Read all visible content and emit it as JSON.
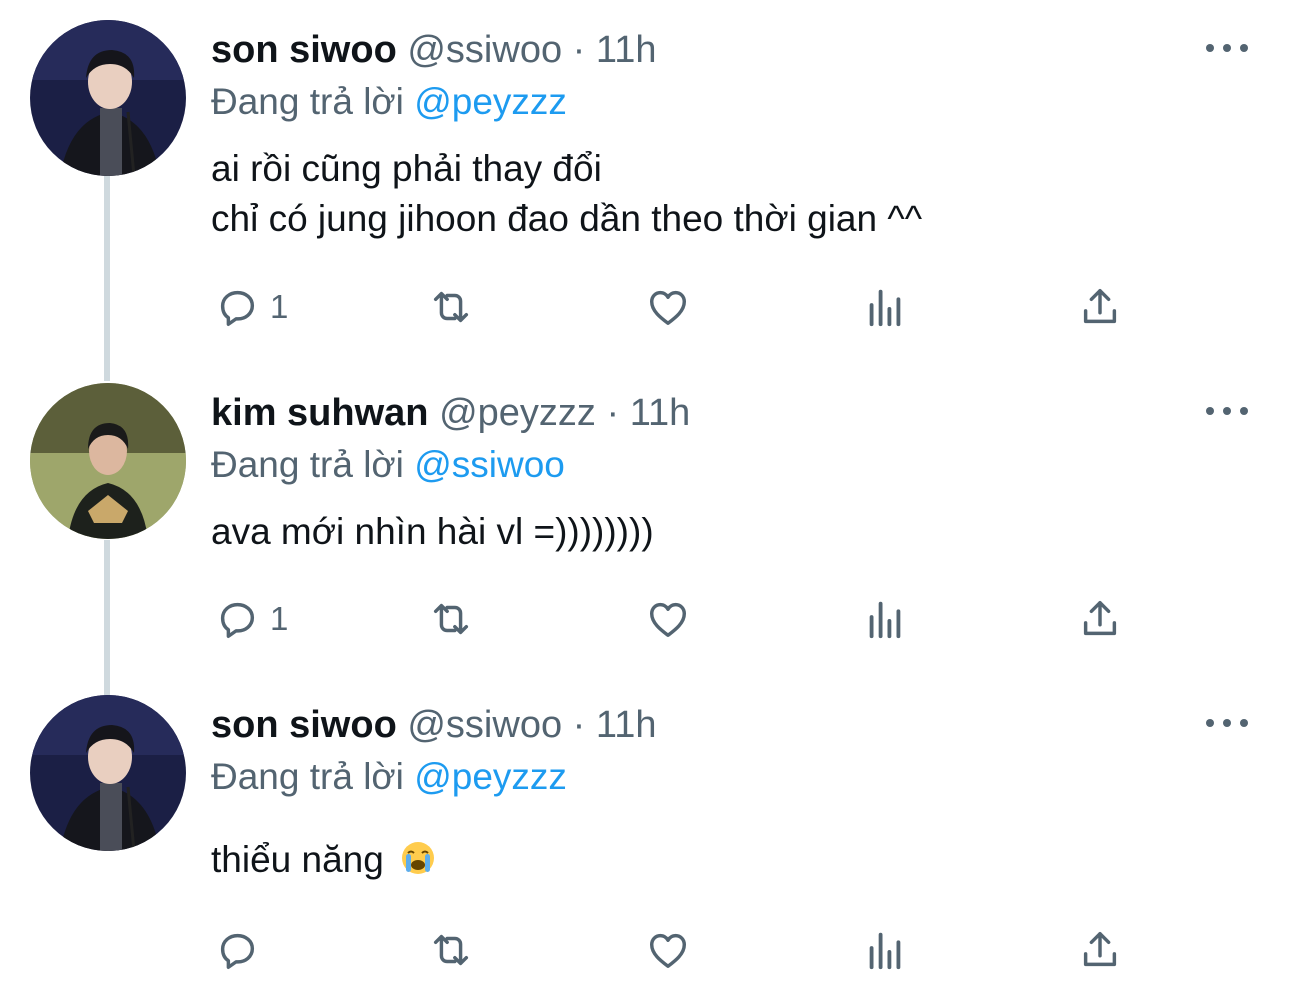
{
  "tweets": [
    {
      "name": "son siwoo",
      "handle": "@ssiwoo",
      "dot": "·",
      "time": "11h",
      "reply_prefix": "Đang trả lời",
      "reply_mention": "@peyzzz",
      "lines": [
        "ai rồi cũng phải thay đổi",
        "chỉ có jung jihoon đao dần theo thời gian ^^"
      ],
      "reply_count": "1"
    },
    {
      "name": "kim suhwan",
      "handle": "@peyzzz",
      "dot": "·",
      "time": "11h",
      "reply_prefix": "Đang trả lời",
      "reply_mention": "@ssiwoo",
      "lines": [
        "ava mới nhìn hài vl =))))))))"
      ],
      "reply_count": "1"
    },
    {
      "name": "son siwoo",
      "handle": "@ssiwoo",
      "dot": "·",
      "time": "11h",
      "reply_prefix": "Đang trả lời",
      "reply_mention": "@peyzzz",
      "lines": [
        "thiểu năng"
      ],
      "body_emoji": "loudly-crying-face-emoji",
      "reply_count": ""
    }
  ],
  "icons": {
    "reply": "reply-icon",
    "retweet": "retweet-icon",
    "like": "heart-icon",
    "views": "views-icon",
    "share": "share-icon",
    "more": "more-options-icon"
  },
  "colors": {
    "text": "#0f1419",
    "secondary": "#536471",
    "link": "#1d9bf0",
    "thread_line": "#cfd9de"
  }
}
